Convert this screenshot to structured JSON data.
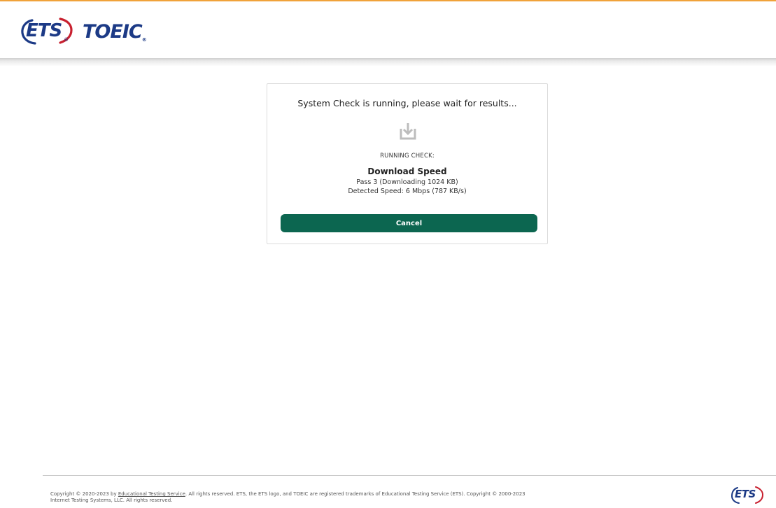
{
  "header": {
    "logo_ets_text": "ETS",
    "logo_reg_mark": "®",
    "logo_product_text": "TOEIC",
    "logo_product_reg_mark": "®",
    "accent_color": "#f0a23a",
    "brand_color": "#1c3a86"
  },
  "system_check": {
    "title": "System Check is running, please wait for results...",
    "icon": "download-icon",
    "running_label": "RUNNING CHECK:",
    "check_name": "Download Speed",
    "pass_status": "Pass 3 (Downloading 1024 KB)",
    "detected_speed": "Detected Speed: 6 Mbps (787 KB/s)",
    "cancel_label": "Cancel",
    "button_color": "#0c6650"
  },
  "footer": {
    "copyright_prefix": "Copyright © 2020-2023 by ",
    "ets_link": "Educational Testing Service",
    "copyright_suffix": ". All rights reserved. ETS, the ETS logo, and TOEIC are registered trademarks of Educational Testing Service (ETS). Copyright © 2000-2023",
    "copyright_line2": "Internet Testing Systems, LLC. All rights reserved.",
    "logo_text": "ETS"
  }
}
